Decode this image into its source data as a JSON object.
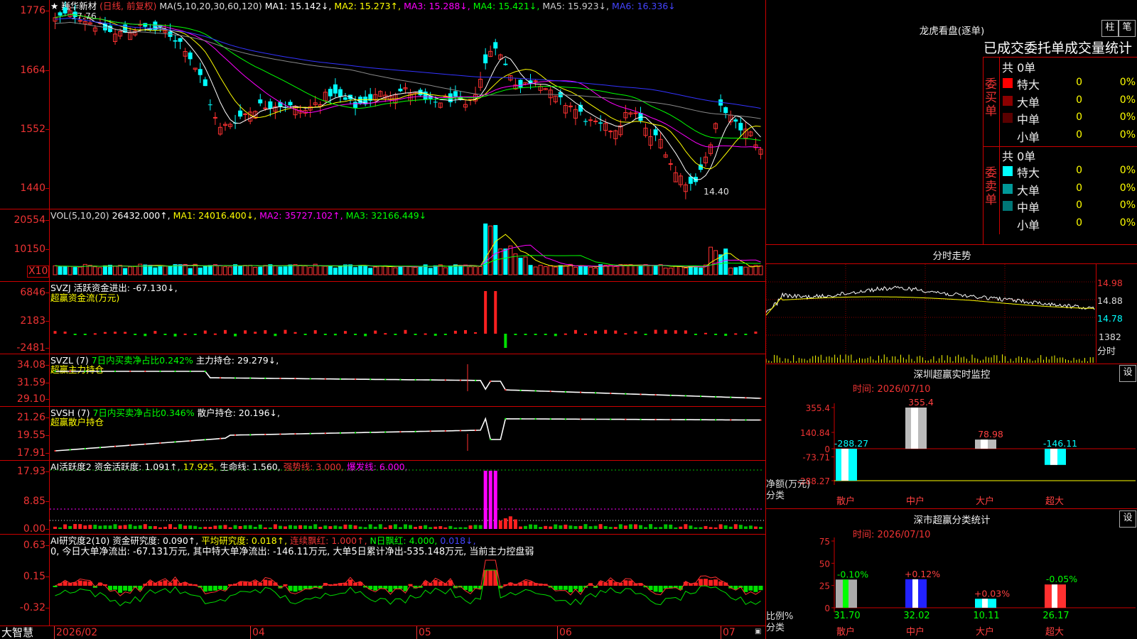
{
  "app_name": "大智慧",
  "stock": {
    "title": "★ 巍华新材",
    "period": "(日线, 前复权)"
  },
  "ma_indicator": {
    "params": "MA(5,10,20,30,60,120)",
    "ma1": "MA1: 15.142↓,",
    "ma2": "MA2: 15.273↑,",
    "ma3": "MA3: 15.288↓,",
    "ma4": "MA4: 15.421↓,",
    "ma5": "MA5: 15.923↓,",
    "ma6": "MA6: 16.336↓"
  },
  "price_axis": [
    "1776",
    "1664",
    "1552",
    "1440"
  ],
  "price_high_label": "17.76",
  "price_low_label": "14.40",
  "vol_indicator": {
    "params": "VOL(5,10,20)",
    "value": "26432.000↑,",
    "ma1": "MA1: 24016.400↓,",
    "ma2": "MA2: 35727.102↑,",
    "ma3": "MA3: 32166.449↓"
  },
  "vol_axis": [
    "20554",
    "10150"
  ],
  "vol_unit": "X10",
  "svzj": {
    "line1": "SVZJ  活跃资金进出: -67.130↓,",
    "line2": "超赢资金流(万元)",
    "axis": [
      "6846",
      "2183",
      "-2481"
    ]
  },
  "svzl": {
    "prefix": "SVZL (7)",
    "ratio": "7日内买卖净占比0.242%",
    "hold": "主力持仓: 29.279↓,",
    "line2": "超赢主力持仓",
    "axis": [
      "34.08",
      "31.59",
      "29.10"
    ]
  },
  "svsh": {
    "prefix": "SVSH (7)",
    "ratio": "7日内买卖净占比0.346%",
    "hold": "散户持仓: 20.196↓,",
    "line2": "超赢散户持仓",
    "axis": [
      "21.26",
      "19.55",
      "17.91"
    ]
  },
  "ai_active": {
    "a": "AI活跃度2 资金活跃度: 1.091↑,",
    "b": "17.925,",
    "c": "生命线: 1.560,",
    "d": "强势线: 3.000,",
    "e": "爆发线: 6.000,",
    "axis": [
      "17.93",
      "8.85",
      "0.00"
    ]
  },
  "ai_research": {
    "a": "AI研究度2(10) 资金研究度: 0.090↑,",
    "b": "平均研究度: 0.018↑,",
    "c": "连续飘红: 1.000↑,",
    "d": "N日飘红: 4.000,",
    "e": "0.018↓,",
    "summary": "0, 今日大单净流出: -67.131万元, 其中特大单净流出: -146.11万元, 大单5日累计净出-535.148万元, 当前主力控盘弱",
    "axis": [
      "0.63",
      "0.15",
      "-0.32"
    ]
  },
  "date_axis": [
    "2026/02",
    "04",
    "05",
    "06",
    "07"
  ],
  "orderbook": {
    "title": "龙虎看盘(逐单)",
    "btn_bar": "柱",
    "btn_stroke": "笔",
    "subtitle": "已成交委托单成交量统计",
    "buy_label": "委买单",
    "sell_label": "委卖单",
    "buy_total": "共 0单",
    "sell_total": "共 0单",
    "buy_rows": [
      {
        "label": "特大",
        "count": "0",
        "pct": "0%",
        "color": "#ff0000"
      },
      {
        "label": "大单",
        "count": "0",
        "pct": "0%",
        "color": "#8b0000"
      },
      {
        "label": "中单",
        "count": "0",
        "pct": "0%",
        "color": "#5a0000"
      },
      {
        "label": "小单",
        "count": "0",
        "pct": "0%",
        "color": "#000000"
      }
    ],
    "sell_rows": [
      {
        "label": "特大",
        "count": "0",
        "pct": "0%",
        "color": "#00ffff"
      },
      {
        "label": "大单",
        "count": "0",
        "pct": "0%",
        "color": "#009999"
      },
      {
        "label": "中单",
        "count": "0",
        "pct": "0%",
        "color": "#007777"
      },
      {
        "label": "小单",
        "count": "0",
        "pct": "0%",
        "color": "#000000"
      }
    ]
  },
  "intraday": {
    "title": "分时走势",
    "prices": [
      "14.98",
      "14.88",
      "14.78"
    ],
    "vol_label": "1382",
    "time_label": "分时"
  },
  "sz_monitor": {
    "title": "深圳超赢实时监控",
    "settings": "设",
    "date": "时间: 2026/07/10",
    "axis": [
      "355.4",
      "140.84",
      "0",
      "-73.71",
      "-288.27"
    ],
    "row_label1": "净额(万元)",
    "row_label2": "分类",
    "bars": [
      {
        "name": "散户",
        "value": -288.27,
        "label": "-288.27"
      },
      {
        "name": "中户",
        "value": 355.4,
        "label": "355.4"
      },
      {
        "name": "大户",
        "value": 78.98,
        "label": "78.98"
      },
      {
        "name": "超大",
        "value": -146.11,
        "label": "-146.11"
      }
    ]
  },
  "sz_stats": {
    "title": "深市超赢分类统计",
    "settings": "设",
    "date": "时间: 2026/07/10",
    "axis": [
      "75",
      "50",
      "25",
      "0"
    ],
    "row_label1": "比例%",
    "row_label2": "分类",
    "bars": [
      {
        "name": "散户",
        "value": 31.7,
        "value_label": "31.70",
        "change": "-0.10%"
      },
      {
        "name": "中户",
        "value": 32.02,
        "value_label": "32.02",
        "change": "+0.12%"
      },
      {
        "name": "大户",
        "value": 10.11,
        "value_label": "10.11",
        "change": "+0.03%"
      },
      {
        "name": "超大",
        "value": 26.17,
        "value_label": "26.17",
        "change": "-0.05%"
      }
    ]
  },
  "colors": {
    "up": "#ff3232",
    "down": "#00ffff",
    "axis": "#cc0000",
    "ma1": "#ffffff",
    "ma2": "#ffff00",
    "ma3": "#ff00ff",
    "ma4": "#00ff00",
    "ma5": "#888888",
    "ma6": "#3333ff"
  }
}
